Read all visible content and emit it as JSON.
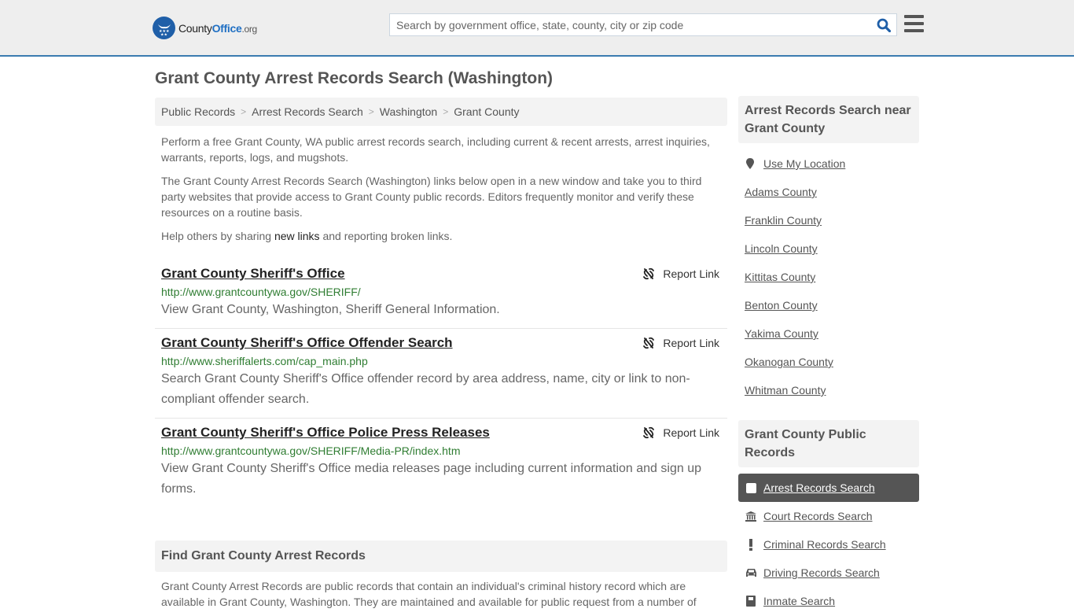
{
  "header": {
    "logo": {
      "brand_county": "County",
      "brand_office": "Office",
      "brand_tld": ".org"
    },
    "search": {
      "placeholder": "Search by government office, state, county, city or zip code",
      "value": ""
    },
    "icons": {
      "search": "search-icon",
      "menu": "hamburger-menu-icon"
    },
    "colors": {
      "accent_border": "#3b7bb0",
      "search_icon": "#1f5fa8",
      "logo_blue": "#1f6fc3"
    }
  },
  "page": {
    "title": "Grant County Arrest Records Search (Washington)"
  },
  "breadcrumb": [
    {
      "label": "Public Records"
    },
    {
      "label": "Arrest Records Search"
    },
    {
      "label": "Washington"
    },
    {
      "label": "Grant County"
    }
  ],
  "breadcrumb_separator": ">",
  "intro": {
    "p1": "Perform a free Grant County, WA public arrest records search, including current & recent arrests, arrest inquiries, warrants, reports, logs, and mugshots.",
    "p2": "The Grant County Arrest Records Search (Washington) links below open in a new window and take you to third party websites that provide access to Grant County public records. Editors frequently monitor and verify these resources on a routine basis.",
    "p3_before": "Help others by sharing ",
    "p3_link": "new links",
    "p3_after": " and reporting broken links."
  },
  "links": [
    {
      "title": "Grant County Sheriff's Office",
      "url": "http://www.grantcountywa.gov/SHERIFF/",
      "description": "View Grant County, Washington, Sheriff General Information.",
      "report_label": "Report Link"
    },
    {
      "title": "Grant County Sheriff's Office Offender Search",
      "url": "http://www.sheriffalerts.com/cap_main.php",
      "description": "Search Grant County Sheriff's Office offender record by area address, name, city or link to non-compliant offender search.",
      "report_label": "Report Link"
    },
    {
      "title": "Grant County Sheriff's Office Police Press Releases",
      "url": "http://www.grantcountywa.gov/SHERIFF/Media-PR/index.htm",
      "description": "View Grant County Sheriff's Office media releases page including current information and sign up forms.",
      "report_label": "Report Link"
    }
  ],
  "find": {
    "heading": "Find Grant County Arrest Records",
    "text": "Grant County Arrest Records are public records that contain an individual's criminal history record which are available in Grant County, Washington. They are maintained and available for public request from a number of"
  },
  "sidebar": {
    "nearby_heading": "Arrest Records Search near Grant County",
    "use_location": "Use My Location",
    "nearby": [
      "Adams County",
      "Franklin County",
      "Lincoln County",
      "Kittitas County",
      "Benton County",
      "Yakima County",
      "Okanogan County",
      "Whitman County"
    ],
    "records_heading": "Grant County Public Records",
    "records": [
      {
        "label": "Arrest Records Search",
        "icon": "square-icon",
        "active": true
      },
      {
        "label": "Court Records Search",
        "icon": "courthouse-icon",
        "active": false
      },
      {
        "label": "Criminal Records Search",
        "icon": "exclamation-icon",
        "active": false
      },
      {
        "label": "Driving Records Search",
        "icon": "car-icon",
        "active": false
      },
      {
        "label": "Inmate Search",
        "icon": "inmate-icon",
        "active": false
      }
    ]
  }
}
